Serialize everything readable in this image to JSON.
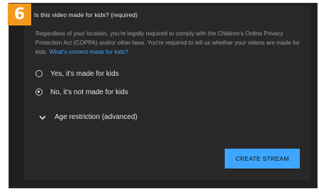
{
  "step_badge": "6",
  "dialog": {
    "title": "Is this video made for kids? (required)",
    "description": "Regardless of your location, you're legally required to comply with the Children's Online Privacy Protection Act (COPPA) and/or other laws. You're required to tell us whether your videos are made for kids.",
    "help_link": "What's content made for kids?",
    "options": [
      {
        "label": "Yes, it's made for kids",
        "selected": false
      },
      {
        "label": "No, it's not made for kids",
        "selected": true
      }
    ],
    "age_restriction_label": "Age restriction (advanced)",
    "create_button": "CREATE STREAM"
  },
  "colors": {
    "badge": "#f39a1d",
    "dialog_bg": "#282828",
    "link": "#3ea6ff",
    "button": "#3ea6ff"
  }
}
